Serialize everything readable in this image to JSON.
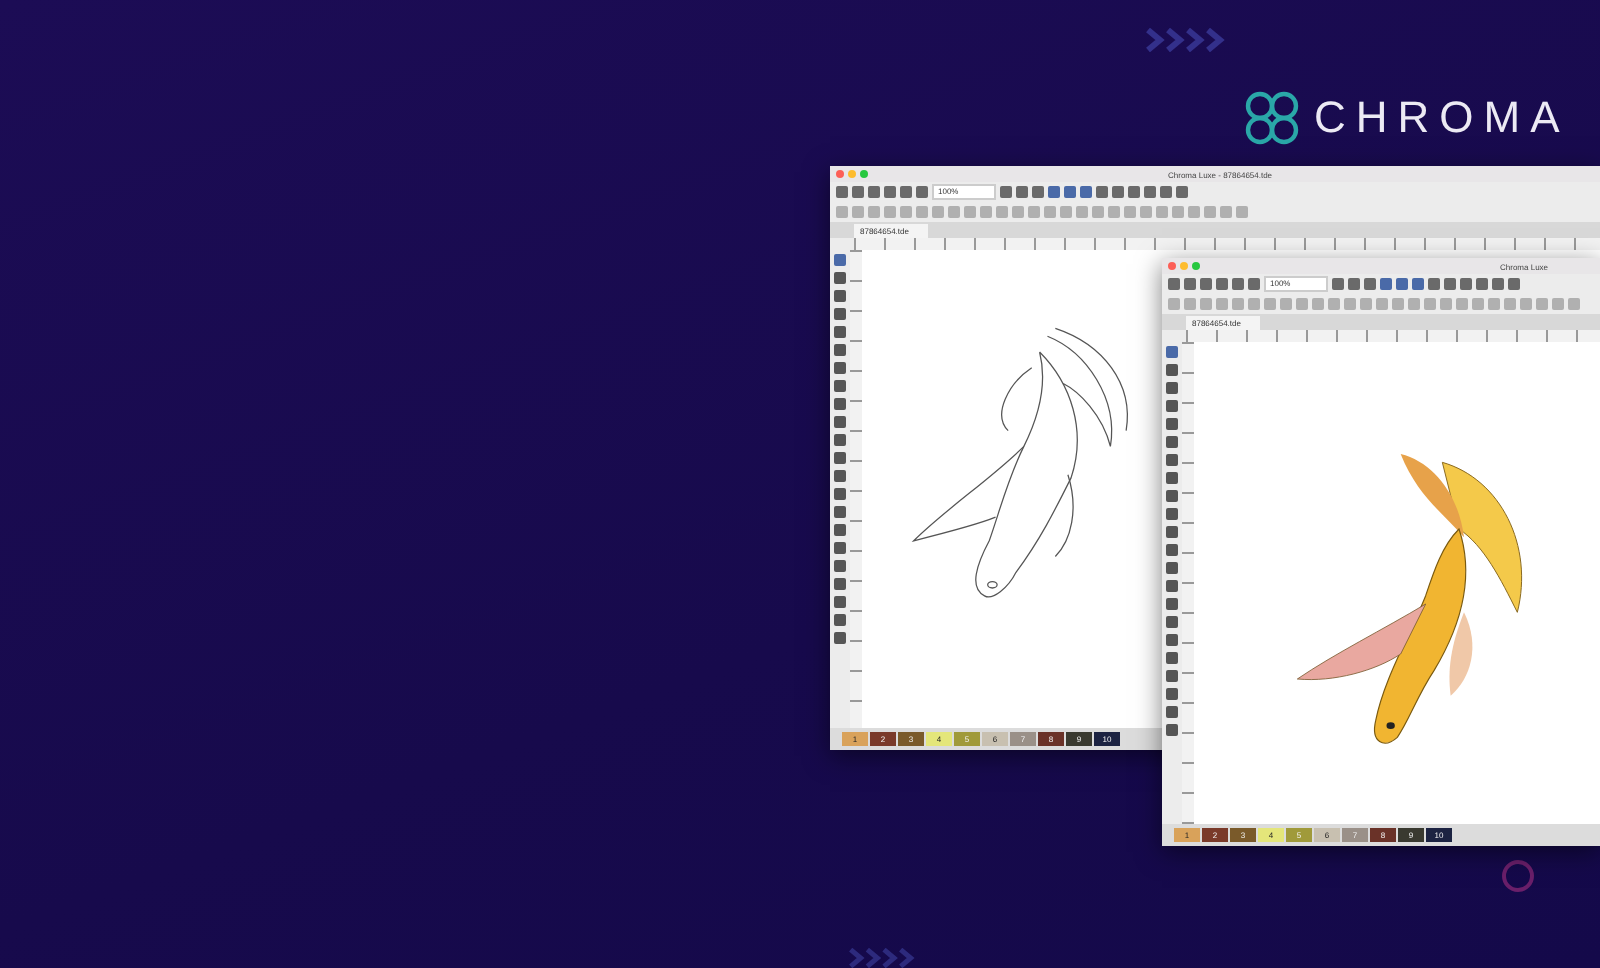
{
  "brand": {
    "name": "CHROMA"
  },
  "windows": [
    {
      "kind": "sketch",
      "title": "Chroma Luxe - 87864654.tde",
      "zoom": "100%",
      "tab": "87864654.tde",
      "palette": [
        {
          "label": "1",
          "color": "#d9a25a"
        },
        {
          "label": "2",
          "color": "#7a3a2a"
        },
        {
          "label": "3",
          "color": "#7a5a2a"
        },
        {
          "label": "4",
          "color": "#e4e67a"
        },
        {
          "label": "5",
          "color": "#a09a3a"
        },
        {
          "label": "6",
          "color": "#c8c0b0"
        },
        {
          "label": "7",
          "color": "#9a9088"
        },
        {
          "label": "8",
          "color": "#6a3228"
        },
        {
          "label": "9",
          "color": "#3a3a30"
        },
        {
          "label": "10",
          "color": "#1c2342"
        }
      ]
    },
    {
      "kind": "color",
      "title": "Chroma Luxe",
      "zoom": "100%",
      "tab": "87864654.tde",
      "palette": [
        {
          "label": "1",
          "color": "#d9a25a"
        },
        {
          "label": "2",
          "color": "#7a3a2a"
        },
        {
          "label": "3",
          "color": "#7a5a2a"
        },
        {
          "label": "4",
          "color": "#e4e67a"
        },
        {
          "label": "5",
          "color": "#a09a3a"
        },
        {
          "label": "6",
          "color": "#c8c0b0"
        },
        {
          "label": "7",
          "color": "#9a9088"
        },
        {
          "label": "8",
          "color": "#6a3228"
        },
        {
          "label": "9",
          "color": "#3a3a30"
        },
        {
          "label": "10",
          "color": "#1c2342"
        }
      ]
    }
  ]
}
